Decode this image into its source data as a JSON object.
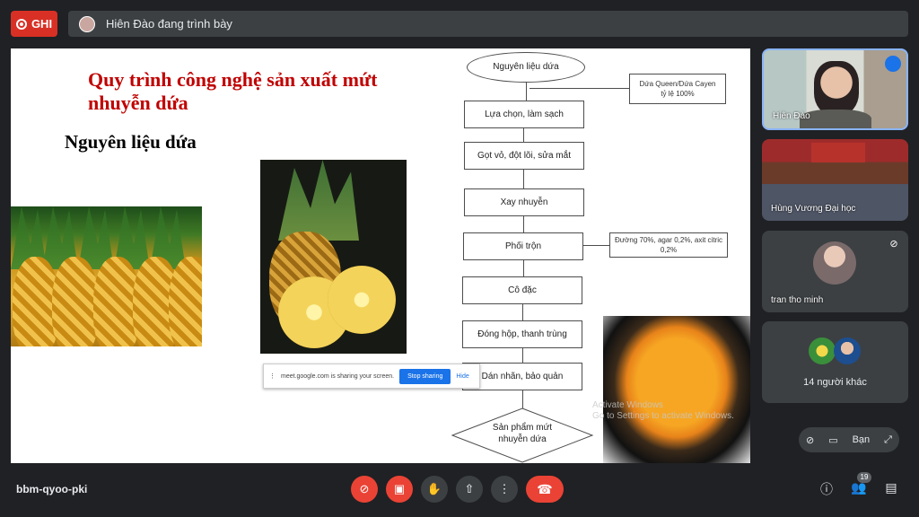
{
  "top": {
    "record_label": "GHI",
    "presenter_text": "Hiên Đào đang trình bày"
  },
  "slide": {
    "title": "Quy trình công nghệ sản xuất mứt nhuyễn dứa",
    "subtitle": "Nguyên liệu dứa",
    "flow_start": "Nguyên liệu dứa",
    "steps": [
      "Lựa chọn, làm sạch",
      "Gọt vỏ, đột lõi, sửa mắt",
      "Xay nhuyễn",
      "Phối trộn",
      "Cô đặc",
      "Đóng hộp, thanh  trùng",
      "Dán nhãn, bảo quản"
    ],
    "flow_end": "Sản phẩm mứt nhuyễn dứa",
    "note1": "Dứa Queen/Dứa Cayen\ntỷ lệ 100%",
    "note2": "Đường 70%, agar 0,2%, axit citric 0,2%",
    "watermark": "Activate Windows\nGo to Settings to activate Windows."
  },
  "share_bar": {
    "text": "meet.google.com is sharing your screen.",
    "stop": "Stop sharing",
    "hide": "Hide"
  },
  "participants": [
    {
      "name": "Hiên Đào"
    },
    {
      "name": "Hùng Vương Đại học"
    },
    {
      "name": "tran tho minh"
    },
    {
      "name": "14 người khác"
    }
  ],
  "self_pill": {
    "label": "Bạn"
  },
  "bottom": {
    "meeting_code": "bbm-qyoo-pki",
    "people_count": "19"
  },
  "colors": {
    "accent_red": "#ea4335",
    "title_red": "#c00000",
    "bg": "#202124"
  }
}
